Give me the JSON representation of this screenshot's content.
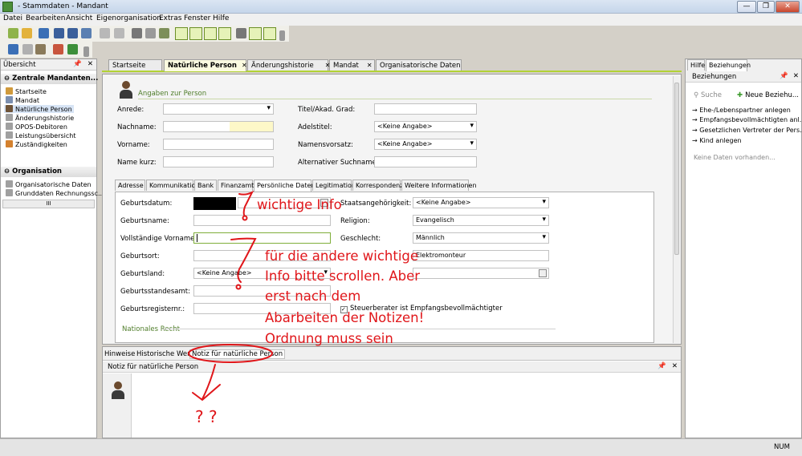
{
  "window": {
    "title": "- Stammdaten - Mandant",
    "buttons": [
      "—",
      "❐",
      "✕"
    ]
  },
  "menu": [
    "Datei",
    "Bearbeiten",
    "Ansicht",
    "Eigenorganisation",
    "Extras",
    "Fenster",
    "Hilfe"
  ],
  "left": {
    "title": "Übersicht",
    "group1": "Zentrale Mandanten...",
    "items1": [
      "Startseite",
      "Mandat",
      "Natürliche Person",
      "Änderungshistorie",
      "OPOS-Debitoren",
      "Leistungsübersicht",
      "Zuständigkeiten"
    ],
    "group2": "Organisation",
    "items2": [
      "Organisatorische Daten",
      "Grunddaten Rechnungssc..."
    ],
    "scroll": "III"
  },
  "tabs": [
    "Startseite",
    "Natürliche Person",
    "Änderungshistorie",
    "Mandat",
    "Organisatorische Daten"
  ],
  "person": {
    "section": "Angaben zur Person",
    "anrede": "Anrede:",
    "nachname": "Nachname:",
    "vorname": "Vorname:",
    "namekurz": "Name kurz:",
    "titel": "Titel/Akad. Grad:",
    "adel": "Adelstitel:",
    "adel_val": "<Keine Angabe>",
    "nvz": "Namensvorsatz:",
    "nvz_val": "<Keine Angabe>",
    "alt": "Alternativer Suchname:"
  },
  "subtabs": [
    "Adresse",
    "Kommunikation",
    "Bank",
    "Finanzamt",
    "Persönliche Daten",
    "Legitimation",
    "Korrespondenz",
    "Weitere Informationen"
  ],
  "pd": {
    "geburtsdatum": "Geburtsdatum:",
    "geburtsname": "Geburtsname:",
    "vornamen": "Vollständige Vornamen:",
    "geburtsort": "Geburtsort:",
    "geburtsland": "Geburtsland:",
    "geburtsland_val": "<Keine Angabe>",
    "standesamt": "Geburtsstandesamt:",
    "register": "Geburtsregisternr.:",
    "staat": "Staatsangehörigkeit:",
    "staat_val": "<Keine Angabe>",
    "religion": "Religion:",
    "religion_val": "Evangelisch",
    "geschlecht": "Geschlecht:",
    "geschlecht_val": "Männlich",
    "beruf_val": "Elektromonteur",
    "steuer": "Steuerberater ist Empfangsbevollmächtigter",
    "nat_recht": "Nationales Recht"
  },
  "bottom": {
    "tabs": [
      "Hinweise",
      "Historische Werte",
      "Notiz für natürliche Person"
    ],
    "title": "Notiz für natürliche Person"
  },
  "right": {
    "tabs": [
      "Hilfe",
      "Beziehungen"
    ],
    "title": "Beziehungen",
    "suche": "Suche",
    "neu": "Neue Beziehu...",
    "items": [
      "Ehe-/Lebenspartner anlegen",
      "Empfangsbevollmächtigten anl...",
      "Gesetzlichen Vertreter der Pers...",
      "Kind anlegen"
    ],
    "empty": "Keine Daten vorhanden..."
  },
  "status": "NUM",
  "annotations": {
    "a1": "wichtige Info",
    "a2": "für die andere wichtige",
    "a3": "Info bitte scrollen. Aber",
    "a4": "erst nach dem",
    "a5": "Abarbeiten der Notizen!",
    "a6": "Ordnung muss sein",
    "q": "?  ?"
  },
  "colors": {
    "accent": "#b2d235",
    "annotation": "#e0161a"
  }
}
